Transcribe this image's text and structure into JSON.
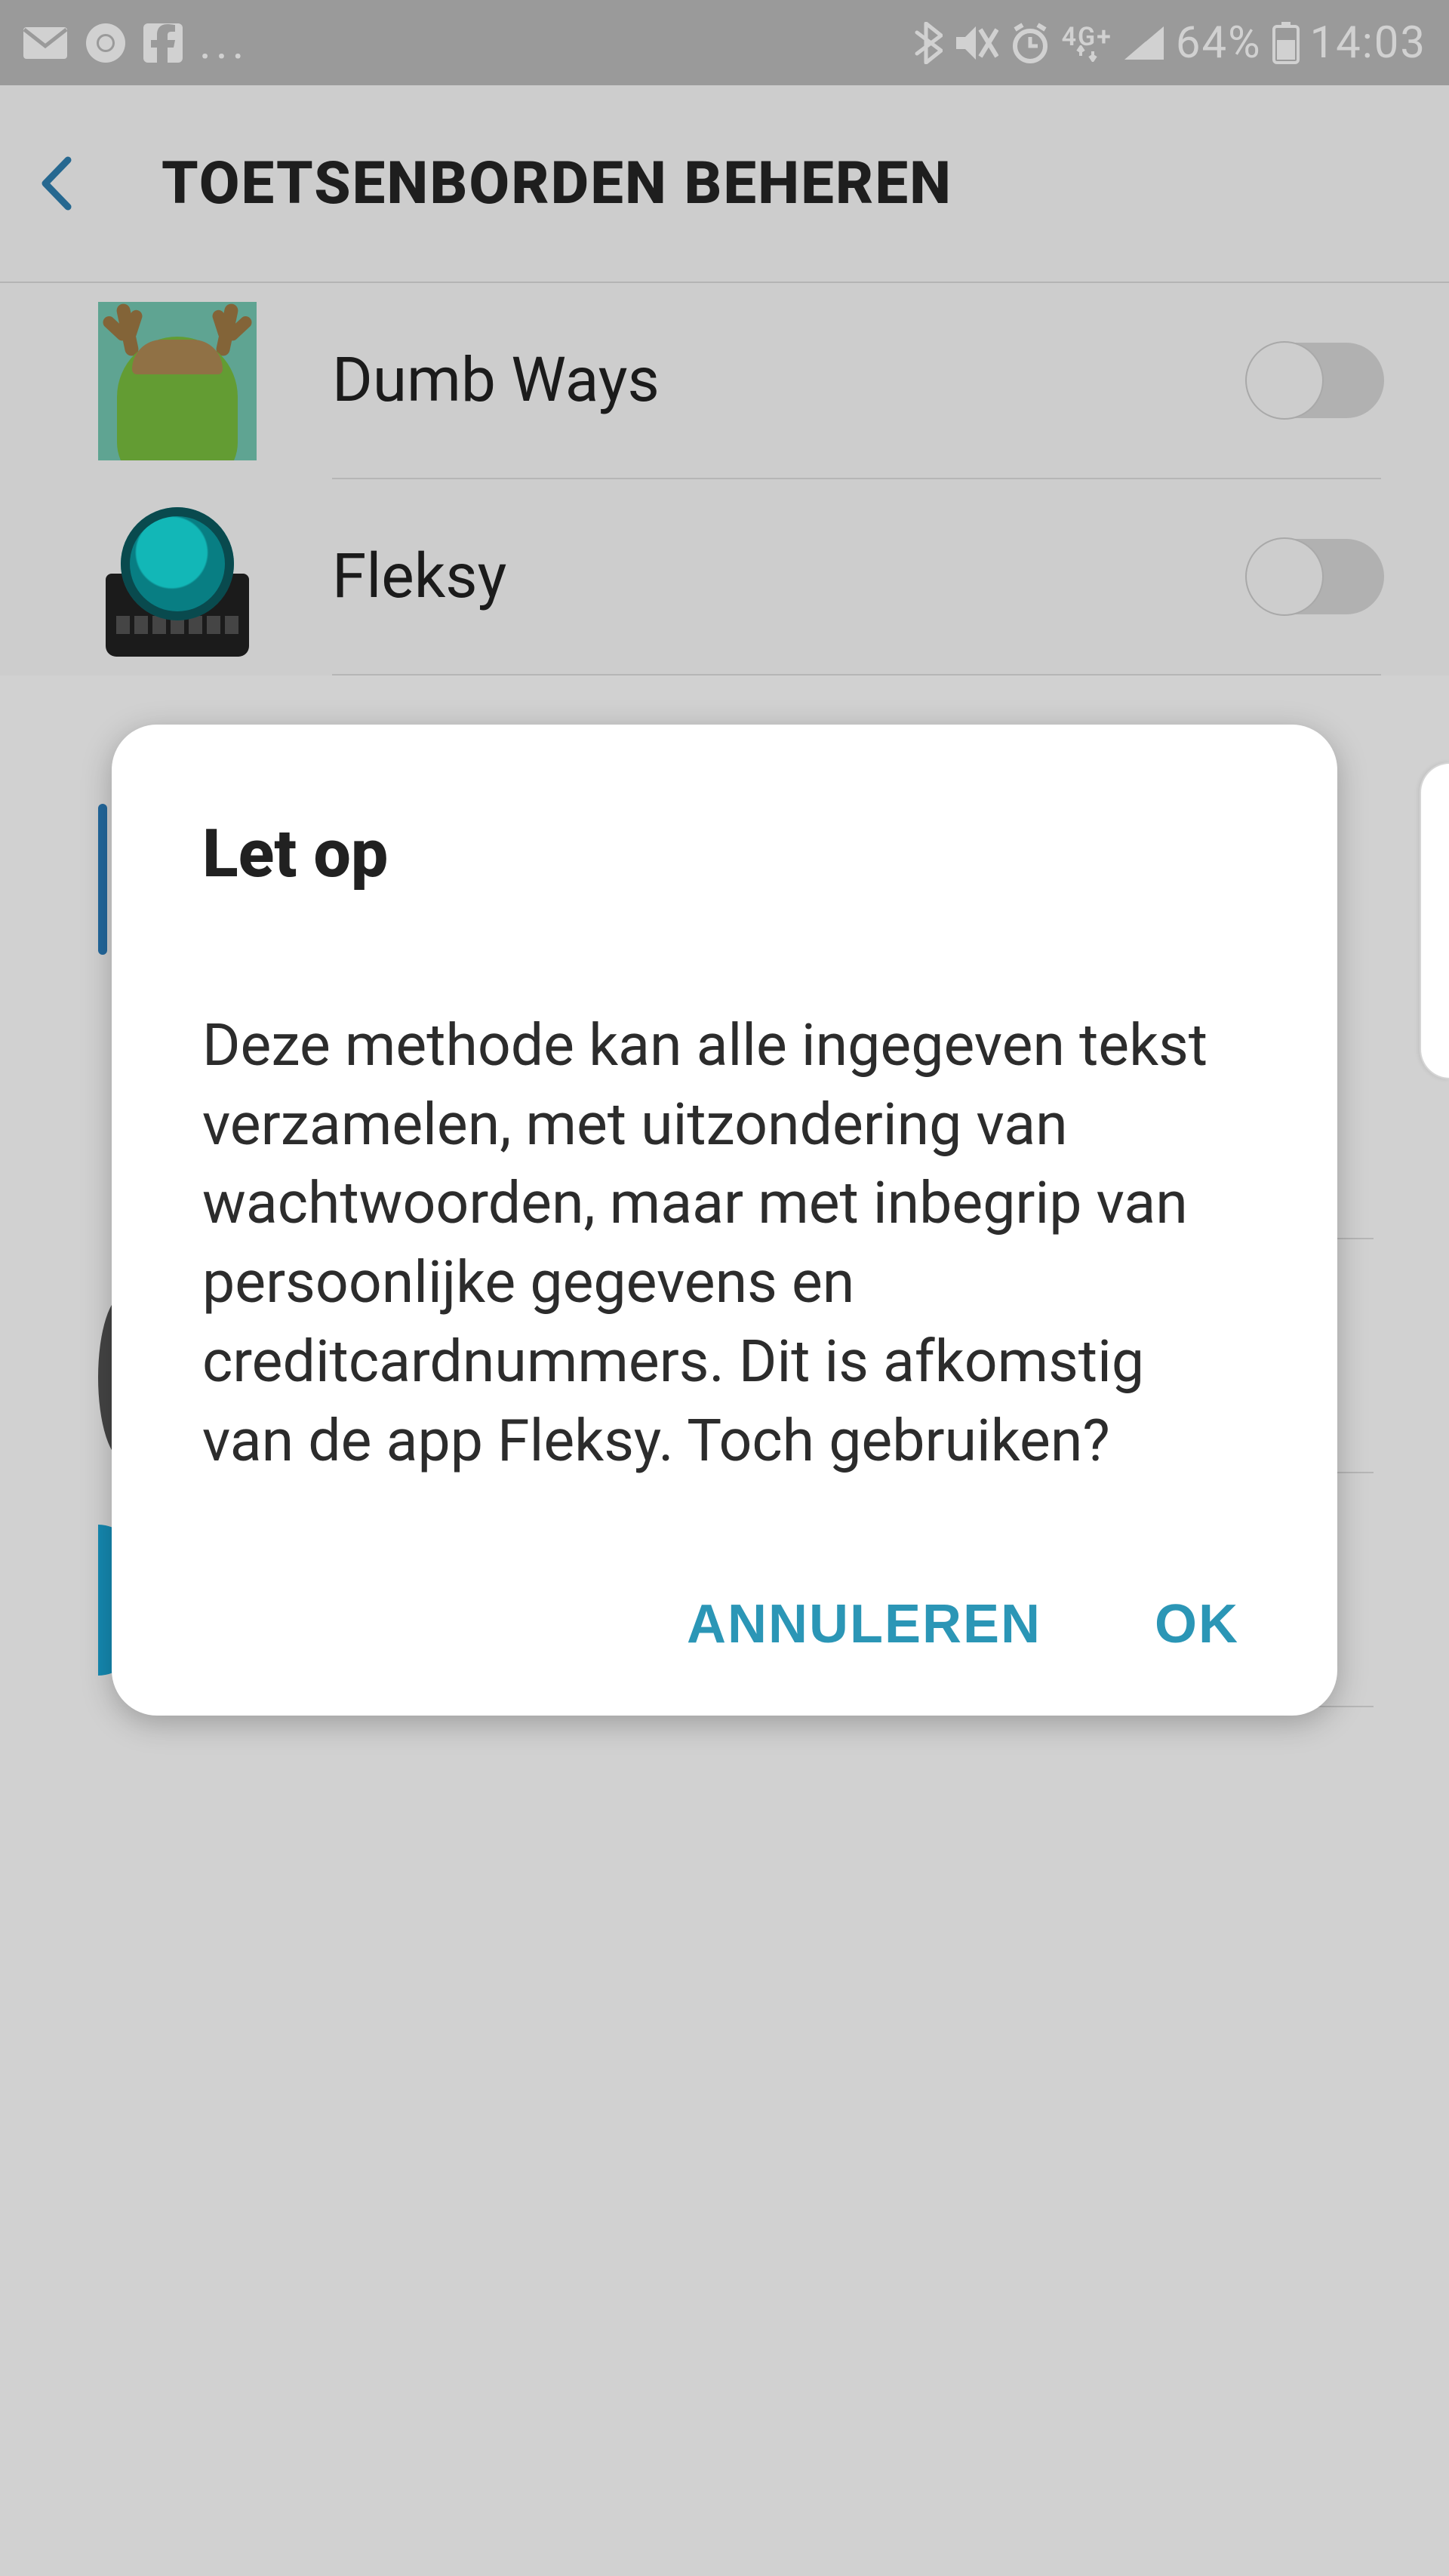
{
  "status_bar": {
    "network_label": "4G+",
    "battery_percent": "64%",
    "clock": "14:03",
    "ellipsis": "..."
  },
  "header": {
    "title": "TOETSENBORDEN BEHEREN"
  },
  "keyboards": [
    {
      "name": "Dumb Ways",
      "enabled": false,
      "icon": "dumbways"
    },
    {
      "name": "Fleksy",
      "enabled": false,
      "icon": "fleksy"
    }
  ],
  "dialog": {
    "title": "Let op",
    "body": "Deze methode kan alle ingegeven tekst verzamelen, met uitzondering van wachtwoorden, maar met inbegrip van persoonlijke gegevens en creditcardnummers. Dit is afkomstig van de app Fleksy. Toch gebruiken?",
    "cancel": "ANNULEREN",
    "ok": "OK"
  }
}
